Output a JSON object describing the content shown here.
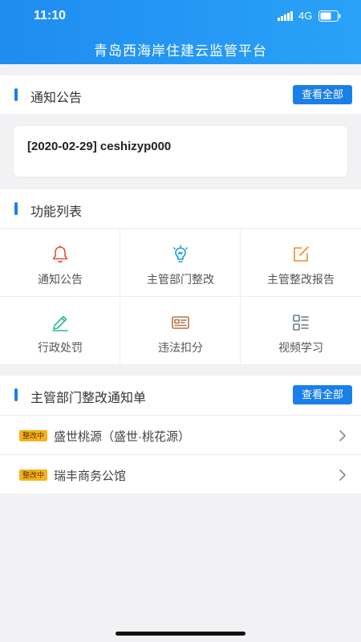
{
  "status_bar": {
    "time": "11:10",
    "network": "4G"
  },
  "header": {
    "title": "青岛西海岸住建云监管平台"
  },
  "notice_section": {
    "title": "通知公告",
    "view_all": "查看全部",
    "latest": "[2020-02-29] ceshizyp000"
  },
  "function_section": {
    "title": "功能列表",
    "items": [
      {
        "label": "通知公告",
        "icon": "bell-icon",
        "color": "#e8503a"
      },
      {
        "label": "主管部门整改",
        "icon": "lightbulb-icon",
        "color": "#1a9be0"
      },
      {
        "label": "主管整改报告",
        "icon": "edit-report-icon",
        "color": "#f08c2a"
      },
      {
        "label": "行政处罚",
        "icon": "pencil-icon",
        "color": "#2fb89a"
      },
      {
        "label": "违法扣分",
        "icon": "id-card-icon",
        "color": "#b4764a"
      },
      {
        "label": "视频学习",
        "icon": "list-grid-icon",
        "color": "#6a7a8c"
      }
    ]
  },
  "rectify_section": {
    "title": "主管部门整改通知单",
    "view_all": "查看全部",
    "items": [
      {
        "badge": "整改中",
        "label": "盛世桃源（盛世·桃花源）"
      },
      {
        "badge": "整改中",
        "label": "瑞丰商务公馆"
      }
    ]
  },
  "colors": {
    "primary": "#1a7fe8",
    "badge": "#f6b21c",
    "background": "#f2f2f4"
  }
}
